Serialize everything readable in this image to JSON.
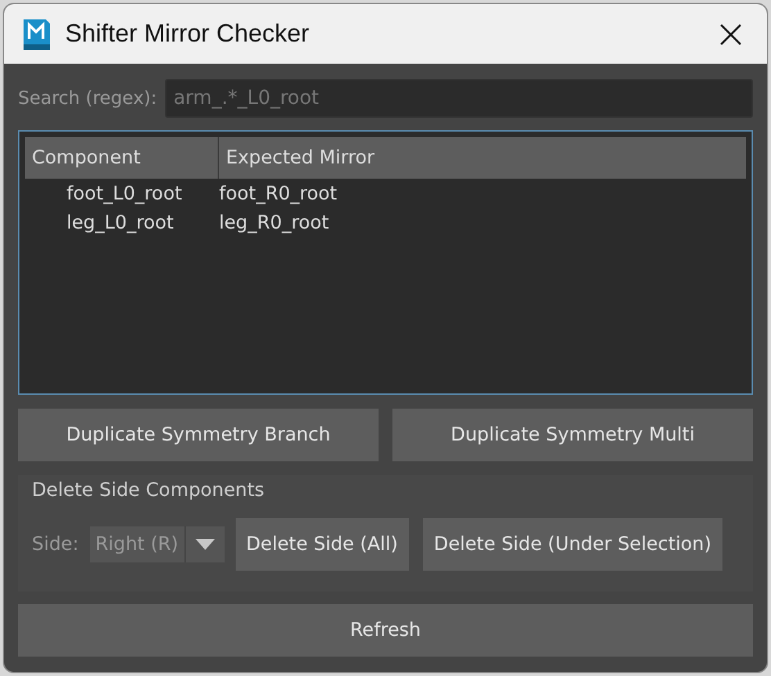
{
  "window": {
    "title": "Shifter Mirror Checker"
  },
  "search": {
    "label": "Search (regex):",
    "placeholder": "arm_.*_L0_root"
  },
  "table": {
    "columns": [
      "Component",
      "Expected Mirror"
    ],
    "rows": [
      [
        "foot_L0_root",
        "foot_R0_root"
      ],
      [
        "leg_L0_root",
        "leg_R0_root"
      ]
    ]
  },
  "buttons": [
    "Duplicate Symmetry Branch",
    "Duplicate Symmetry Multi"
  ],
  "delete_group": {
    "title": "Delete Side Components",
    "side_label": "Side:",
    "side_value": "Right (R)",
    "buttons": [
      "Delete Side (All)",
      "Delete Side (Under Selection)"
    ]
  },
  "refresh": "Refresh"
}
